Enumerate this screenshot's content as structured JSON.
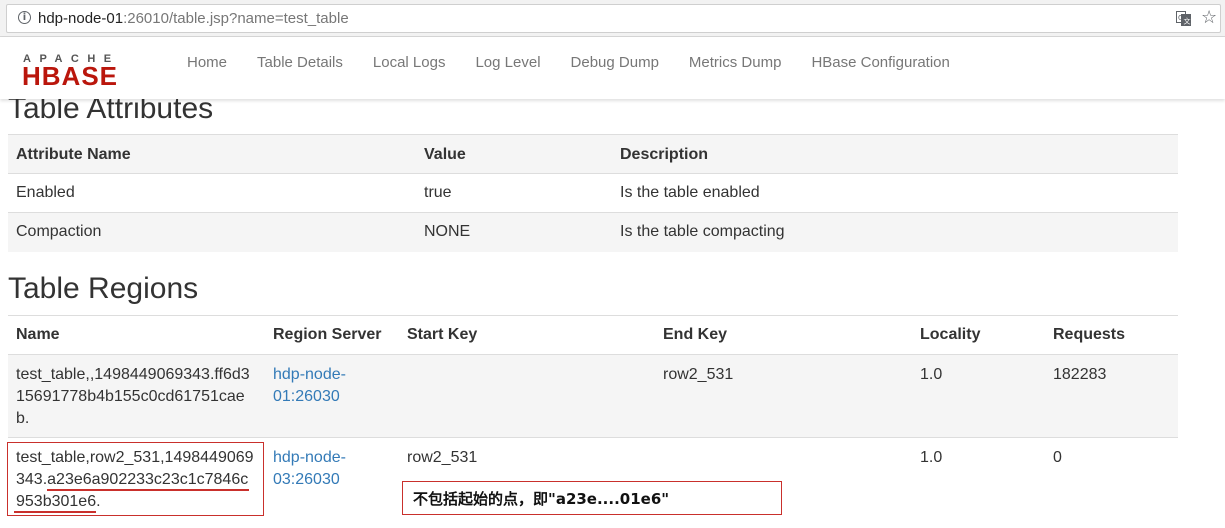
{
  "browser": {
    "url_host": "hdp-node-01",
    "url_rest": ":26010/table.jsp?name=test_table"
  },
  "navbar": {
    "logo_top": "APACHE",
    "logo_main": "HBASE",
    "links": [
      "Home",
      "Table Details",
      "Local Logs",
      "Log Level",
      "Debug Dump",
      "Metrics Dump",
      "HBase Configuration"
    ]
  },
  "attributes": {
    "title": "Table Attributes",
    "headers": [
      "Attribute Name",
      "Value",
      "Description"
    ],
    "rows": [
      [
        "Enabled",
        "true",
        "Is the table enabled"
      ],
      [
        "Compaction",
        "NONE",
        "Is the table compacting"
      ]
    ]
  },
  "regions": {
    "title": "Table Regions",
    "headers": [
      "Name",
      "Region Server",
      "Start Key",
      "End Key",
      "Locality",
      "Requests"
    ],
    "rows": [
      {
        "name": "test_table,,1498449069343.ff6d315691778b4b155c0cd61751caeb.",
        "server": "hdp-node-01:26030",
        "start_key": "",
        "end_key": "row2_531",
        "locality": "1.0",
        "requests": "182283"
      },
      {
        "name": "test_table,row2_531,1498449069343.a23e6a902233c23c1c7846c953b301e6.",
        "server": "hdp-node-03:26030",
        "start_key": "row2_531",
        "end_key": "",
        "locality": "1.0",
        "requests": "0"
      }
    ]
  },
  "annotation": {
    "note": "不包括起始的点，即\"a23e....01e6\"",
    "color": "#c9302c"
  },
  "colors": {
    "link": "#337ab7",
    "hbase_red": "#ba160c"
  }
}
